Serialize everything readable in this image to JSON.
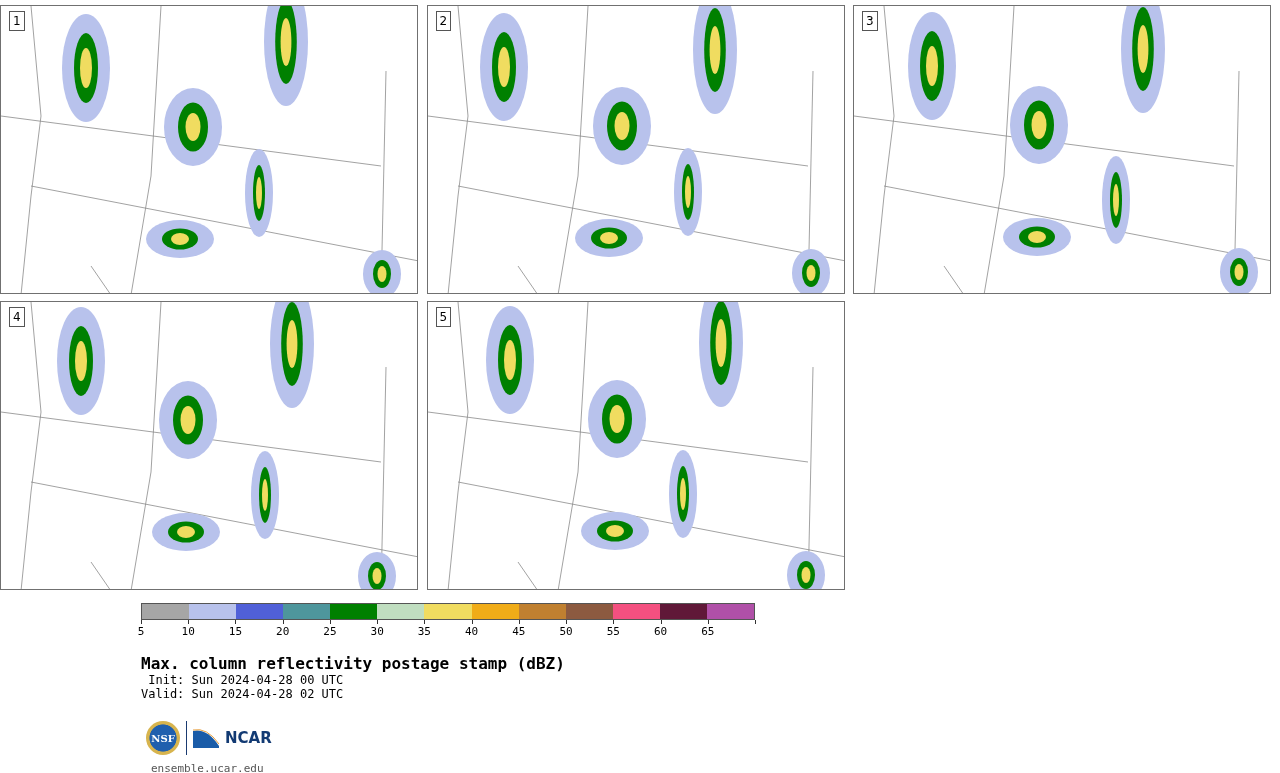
{
  "panels": [
    {
      "label": "1"
    },
    {
      "label": "2"
    },
    {
      "label": "3"
    },
    {
      "label": "4"
    },
    {
      "label": "5"
    }
  ],
  "colorbar": {
    "segments": [
      {
        "color": "#a6a6a6"
      },
      {
        "color": "#b8c2ec"
      },
      {
        "color": "#5060d8"
      },
      {
        "color": "#4e969c"
      },
      {
        "color": "#008000"
      },
      {
        "color": "#c0dec0"
      },
      {
        "color": "#f0dc60"
      },
      {
        "color": "#f0ac18"
      },
      {
        "color": "#c08030"
      },
      {
        "color": "#8c5a40"
      },
      {
        "color": "#f45080"
      },
      {
        "color": "#601838"
      },
      {
        "color": "#b050a8"
      }
    ],
    "ticks": [
      "5",
      "10",
      "15",
      "20",
      "25",
      "30",
      "35",
      "40",
      "45",
      "50",
      "55",
      "60",
      "65"
    ]
  },
  "title": "Max. column reflectivity postage stamp (dBZ)",
  "init": " Init: Sun 2024-04-28 00 UTC",
  "valid": "Valid: Sun 2024-04-28 02 UTC",
  "logos": {
    "seal": "NSF",
    "brand": "NCAR"
  },
  "footer": "ensemble.ucar.edu"
}
